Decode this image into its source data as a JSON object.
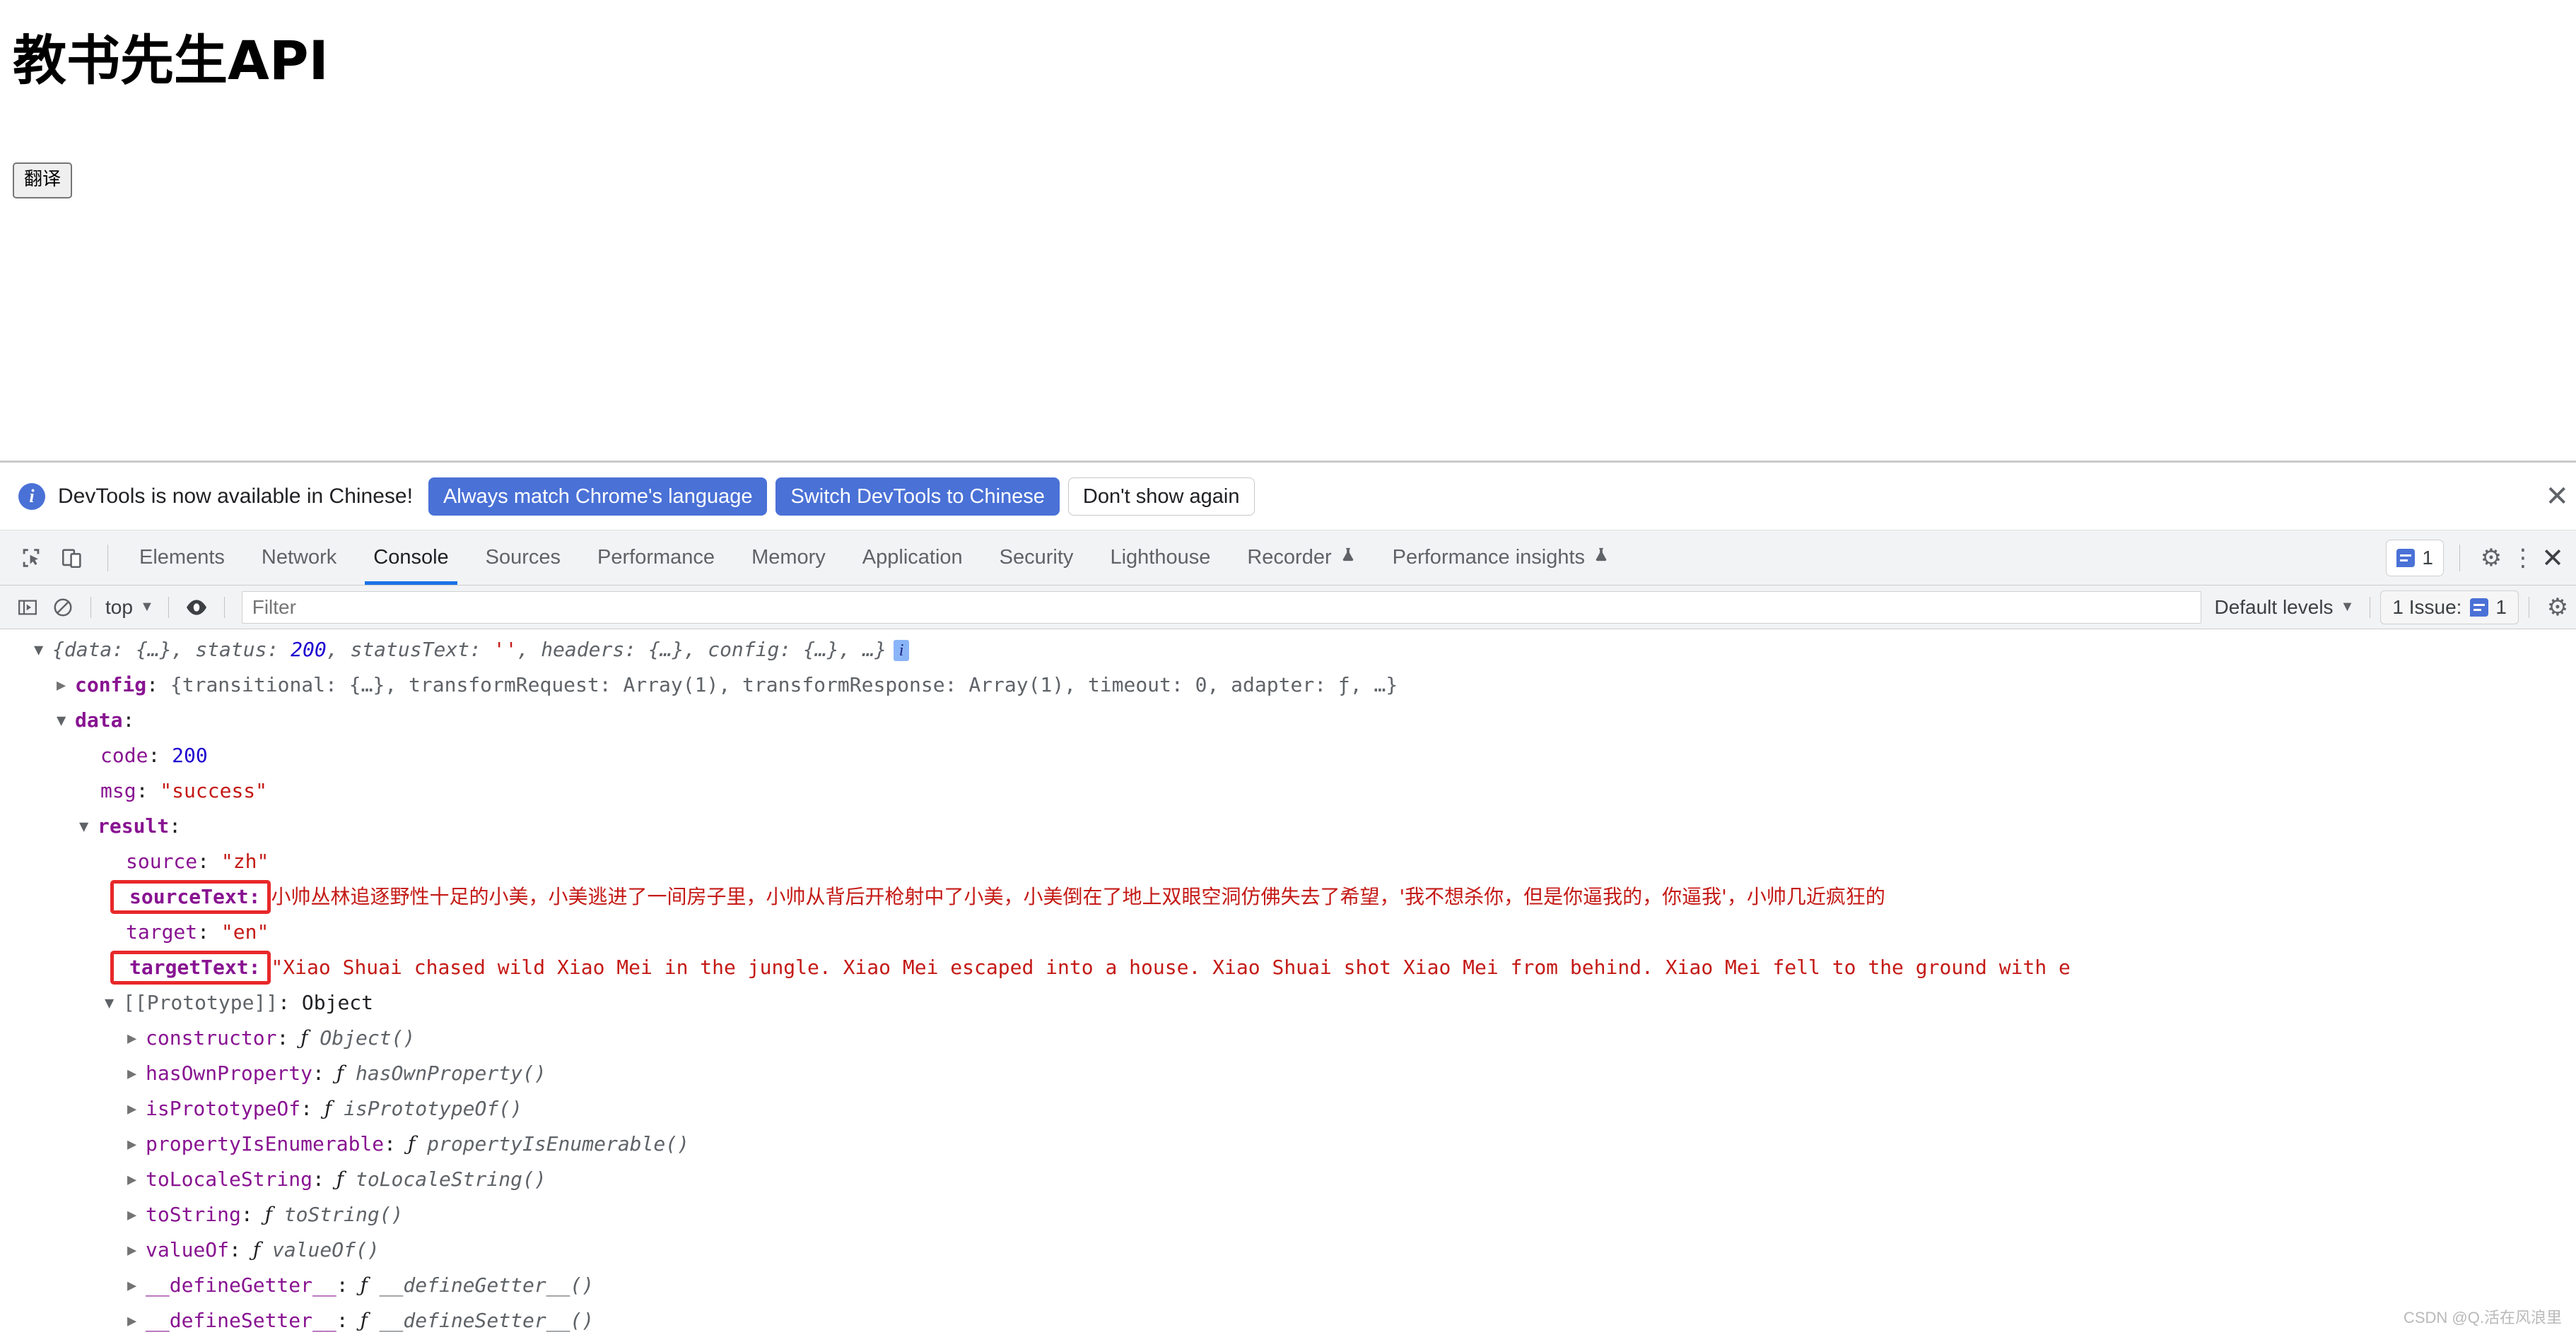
{
  "page": {
    "title": "教书先生API",
    "translate_button": "翻译"
  },
  "devtools": {
    "locale_banner": {
      "icon": "info-icon",
      "message": "DevTools is now available in Chinese!",
      "primary_button": "Always match Chrome's language",
      "secondary_button": "Switch DevTools to Chinese",
      "dismiss_button": "Don't show again",
      "close": "✕"
    },
    "tabs": [
      {
        "label": "Elements",
        "active": false,
        "experimental": false
      },
      {
        "label": "Network",
        "active": false,
        "experimental": false
      },
      {
        "label": "Console",
        "active": true,
        "experimental": false
      },
      {
        "label": "Sources",
        "active": false,
        "experimental": false
      },
      {
        "label": "Performance",
        "active": false,
        "experimental": false
      },
      {
        "label": "Memory",
        "active": false,
        "experimental": false
      },
      {
        "label": "Application",
        "active": false,
        "experimental": false
      },
      {
        "label": "Security",
        "active": false,
        "experimental": false
      },
      {
        "label": "Lighthouse",
        "active": false,
        "experimental": false
      },
      {
        "label": "Recorder",
        "active": false,
        "experimental": true
      },
      {
        "label": "Performance insights",
        "active": false,
        "experimental": true
      }
    ],
    "tabstrip_right": {
      "issues_count": "1",
      "gear": "⚙",
      "kebab": "⋮",
      "close": "✕"
    },
    "console_toolbar": {
      "context": "top",
      "filter_placeholder": "Filter",
      "filter_value": "",
      "levels": "Default levels",
      "issues_label": "1 Issue:",
      "issues_count": "1"
    },
    "accent_colors": {
      "active_tab_underline": "#1a73e8",
      "primary_button": "#4a71d6",
      "annotation_red": "#e8282a",
      "property_purple": "#881391",
      "string_red": "#c41a16",
      "number_blue": "#1c00cf"
    },
    "console_log": {
      "root_preview": "{data: {…}, status: 200, statusText: '', headers: {…}, config: {…}, …}",
      "root_parts": {
        "open": "{",
        "data_key": "data: ",
        "data_val": "{…}",
        "sep1": ", ",
        "status_key": "status: ",
        "status_val": "200",
        "sep2": ", ",
        "statusText_key": "statusText: ",
        "statusText_val": "''",
        "sep3": ", ",
        "headers_key": "headers: ",
        "headers_val": "{…}",
        "sep4": ", ",
        "config_key": "config: ",
        "config_val": "{…}",
        "tail": ", …}",
        "badge": "i"
      },
      "config_row": {
        "key": "config",
        "colon": ": ",
        "value": "{transitional: {…}, transformRequest: Array(1), transformResponse: Array(1), timeout: 0, adapter: ƒ, …}"
      },
      "data_row": {
        "key": "data",
        "colon": ":"
      },
      "code_row": {
        "key": "code",
        "colon": ": ",
        "value": "200"
      },
      "msg_row": {
        "key": "msg",
        "colon": ": ",
        "value": "\"success\""
      },
      "result_row": {
        "key": "result",
        "colon": ":"
      },
      "source_row": {
        "key": "source",
        "colon": ": ",
        "value": "\"zh\""
      },
      "sourceText_row": {
        "key": "sourceText:",
        "value": "小帅丛林追逐野性十足的小美，小美逃进了一间房子里，小帅从背后开枪射中了小美，小美倒在了地上双眼空洞仿佛失去了希望，'我不想杀你，但是你逼我的，你逼我'，小帅几近疯狂的",
        "annotated": true
      },
      "target_row": {
        "key": "target",
        "colon": ": ",
        "value": "\"en\""
      },
      "targetText_row": {
        "key": "targetText:",
        "value": "\"Xiao Shuai chased wild Xiao Mei in the jungle. Xiao Mei escaped into a house. Xiao Shuai shot Xiao Mei from behind. Xiao Mei fell to the ground with e",
        "annotated": true
      },
      "prototype_row": {
        "key": "[[Prototype]]",
        "colon": ": ",
        "value": "Object"
      },
      "prototype_members": [
        {
          "key": "constructor",
          "colon": ": ",
          "fn": "ƒ",
          "sig": "Object()"
        },
        {
          "key": "hasOwnProperty",
          "colon": ": ",
          "fn": "ƒ",
          "sig": "hasOwnProperty()"
        },
        {
          "key": "isPrototypeOf",
          "colon": ": ",
          "fn": "ƒ",
          "sig": "isPrototypeOf()"
        },
        {
          "key": "propertyIsEnumerable",
          "colon": ": ",
          "fn": "ƒ",
          "sig": "propertyIsEnumerable()"
        },
        {
          "key": "toLocaleString",
          "colon": ": ",
          "fn": "ƒ",
          "sig": "toLocaleString()"
        },
        {
          "key": "toString",
          "colon": ": ",
          "fn": "ƒ",
          "sig": "toString()"
        },
        {
          "key": "valueOf",
          "colon": ": ",
          "fn": "ƒ",
          "sig": "valueOf()"
        },
        {
          "key": "__defineGetter__",
          "colon": ": ",
          "fn": "ƒ",
          "sig": "__defineGetter__()"
        },
        {
          "key": "__defineSetter__",
          "colon": ": ",
          "fn": "ƒ",
          "sig": "__defineSetter__()"
        }
      ]
    }
  },
  "watermark": "CSDN @Q.活在风浪里"
}
